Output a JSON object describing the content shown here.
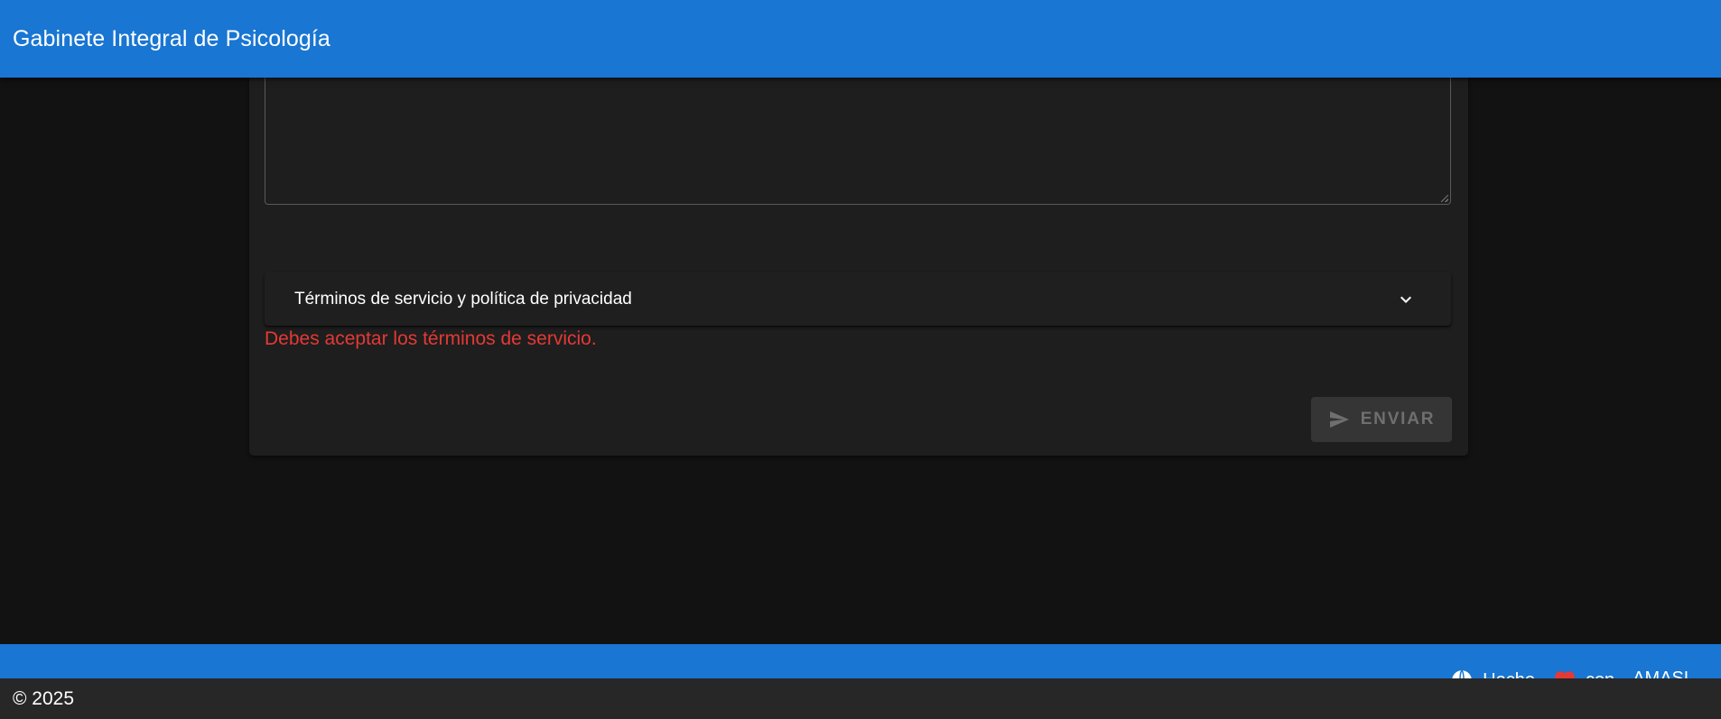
{
  "appbar": {
    "title": "Gabinete Integral de Psicología"
  },
  "form": {
    "textarea_value": "",
    "accordion_label": "Términos de servicio y política de privacidad",
    "error_message": "Debes aceptar los términos de servicio.",
    "send_label": "ENVIAR"
  },
  "footer": {
    "links": [
      {
        "label": "Hecho",
        "icon": "globe-icon"
      },
      {
        "label": "con",
        "icon": "heart-icon"
      },
      {
        "label": "AMASL"
      }
    ],
    "copyright": "© 2025"
  },
  "colors": {
    "primary": "#1976d2",
    "background": "#121212",
    "card": "#1e1e1e",
    "error": "#e53935"
  }
}
